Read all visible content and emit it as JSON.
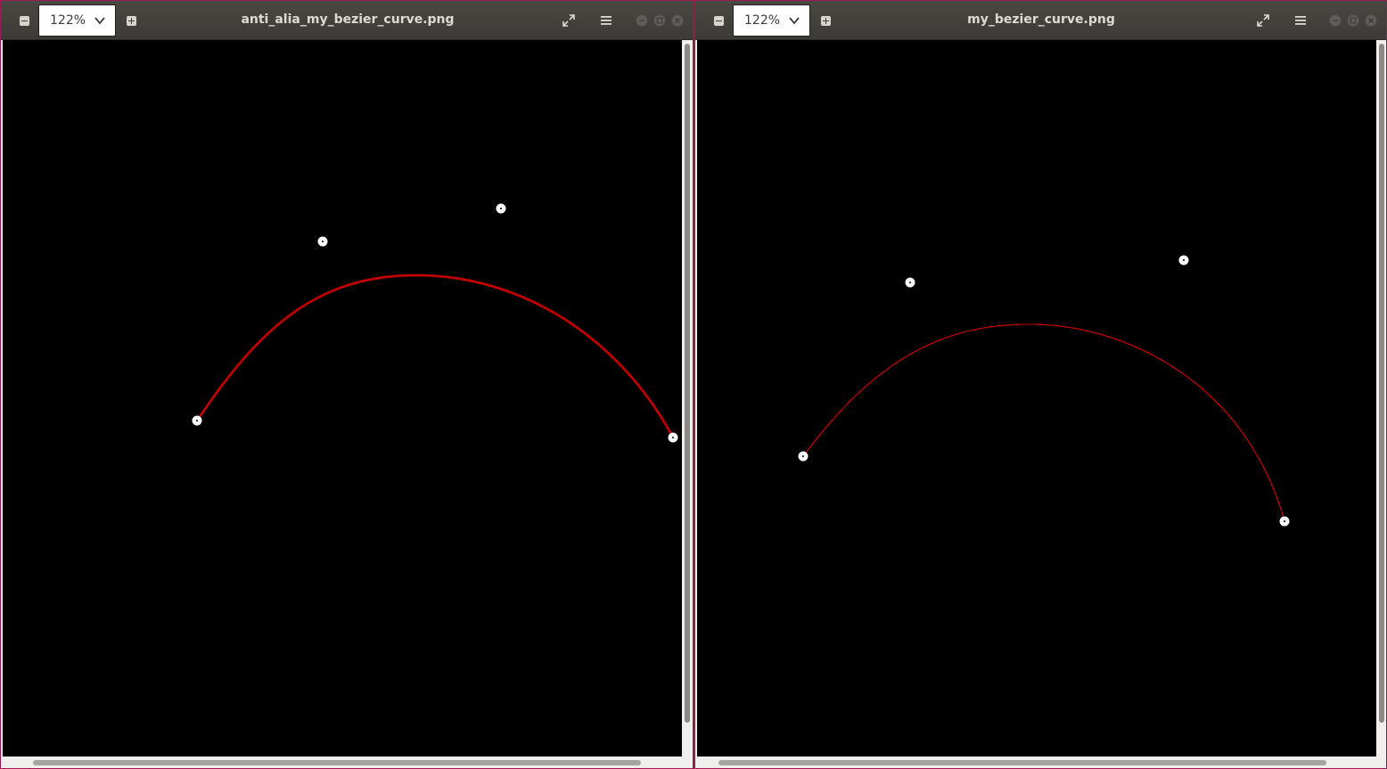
{
  "windows": [
    {
      "title": "anti_alia_my_bezier_curve.png",
      "zoom": "122%",
      "antialiased": true,
      "curve_color": "#c00000",
      "control_point_color": "#ffffff",
      "background_color": "#000000"
    },
    {
      "title": "my_bezier_curve.png",
      "zoom": "122%",
      "antialiased": false,
      "curve_color": "#c00000",
      "control_point_color": "#ffffff",
      "background_color": "#000000"
    }
  ],
  "icons": {
    "zoom_out": "zoom-out-icon",
    "zoom_in": "zoom-in-icon",
    "dropdown": "chevron-down-icon",
    "fullscreen": "fullscreen-icon",
    "menu": "hamburger-menu-icon",
    "minimize": "minimize-icon",
    "maximize": "maximize-icon",
    "close": "close-icon"
  },
  "colors": {
    "titlebar": "#3c3b37",
    "window_border": "#9b1a55",
    "title_text": "#dfdbd2"
  }
}
